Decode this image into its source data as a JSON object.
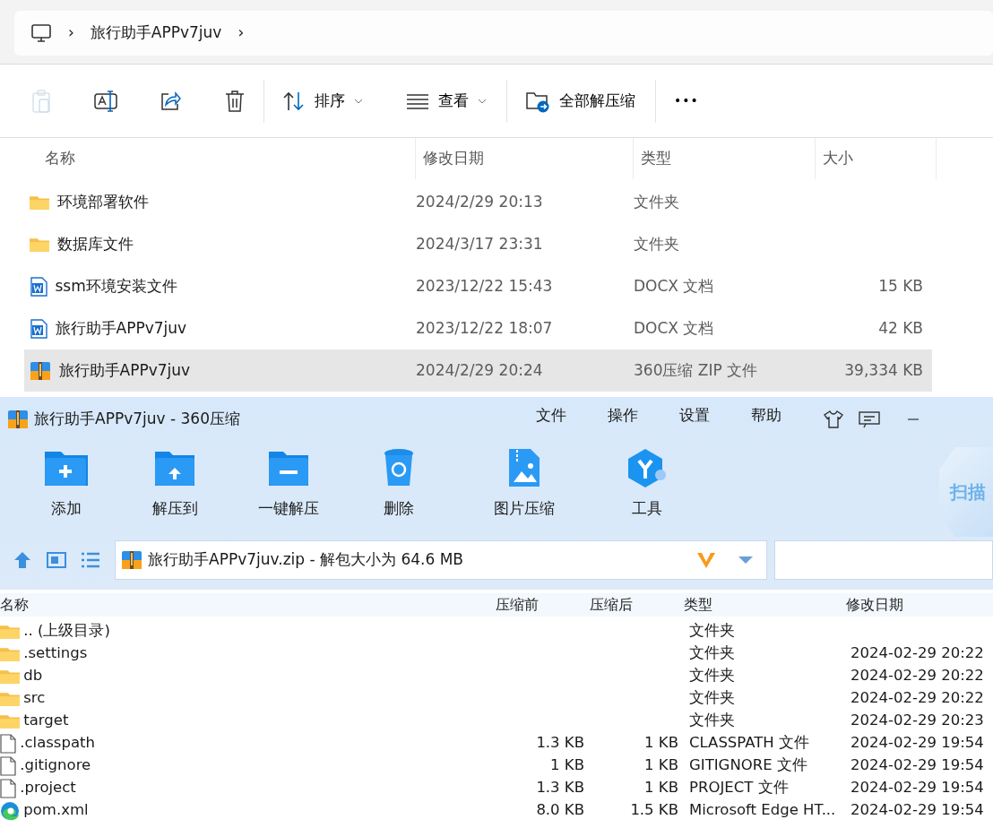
{
  "explorer": {
    "breadcrumb": [
      {
        "kind": "computer"
      },
      {
        "kind": "separator",
        "label": "›"
      },
      {
        "kind": "folder",
        "label": "旅行助手APPv7juv"
      },
      {
        "kind": "separator",
        "label": "›"
      }
    ],
    "toolbar": [
      {
        "kind": "icon",
        "disabled": true
      },
      {
        "kind": "icon",
        "disabled": false
      },
      {
        "kind": "icon",
        "disabled": false
      },
      {
        "kind": "icon",
        "disabled": false
      },
      {
        "kind": "divider"
      },
      {
        "kind": "dropdown",
        "label": "排序"
      },
      {
        "kind": "dropdown",
        "label": "查看"
      },
      {
        "kind": "divider"
      },
      {
        "kind": "text",
        "label": "全部解压缩"
      },
      {
        "kind": "divider"
      },
      {
        "kind": "more",
        "label": "•••"
      }
    ],
    "columns": [
      "名称",
      "修改日期",
      "类型",
      "大小"
    ],
    "rows": [
      {
        "kind": "folder",
        "name": "环境部署软件",
        "date": "2024/2/29 20:13",
        "type": "文件夹",
        "selected": false
      },
      {
        "kind": "folder",
        "name": "数据库文件",
        "date": "2024/3/17 23:31",
        "type": "文件夹",
        "selected": false
      },
      {
        "kind": "document",
        "name": "ssm环境安装文件",
        "date": "2023/12/22 15:43",
        "type": "DOCX 文档",
        "size": "15 KB",
        "selected": false
      },
      {
        "kind": "document",
        "name": "旅行助手APPv7juv",
        "date": "2023/12/22 18:07",
        "type": "DOCX 文档",
        "size": "42 KB",
        "selected": false
      },
      {
        "kind": "archive",
        "name": "旅行助手APPv7juv",
        "date": "2024/2/29 20:24",
        "type": "360压缩 ZIP 文件",
        "size": "39,334 KB",
        "selected": true
      }
    ]
  },
  "archiver": {
    "title": "旅行助手APPv7juv - 360压缩",
    "menu": [
      "文件",
      "操作",
      "设置",
      "帮助"
    ],
    "tools": [
      "添加",
      "解压到",
      "一键解压",
      "删除",
      "图片压缩",
      "工具"
    ],
    "scan_label": "扫描",
    "path": "旅行助手APPv7juv.zip - 解包大小为 64.6 MB",
    "columns": [
      "名称",
      "压缩前",
      "压缩后",
      "类型",
      "修改日期"
    ],
    "rows": [
      {
        "kind": "folder",
        "name": ".. (上级目录)",
        "type": "文件夹"
      },
      {
        "kind": "folder",
        "name": ".settings",
        "type": "文件夹",
        "date": "2024-02-29 20:22"
      },
      {
        "kind": "folder",
        "name": "db",
        "type": "文件夹",
        "date": "2024-02-29 20:22"
      },
      {
        "kind": "folder",
        "name": "src",
        "type": "文件夹",
        "date": "2024-02-29 20:22"
      },
      {
        "kind": "folder",
        "name": "target",
        "type": "文件夹",
        "date": "2024-02-29 20:23"
      },
      {
        "kind": "file",
        "name": ".classpath",
        "before": "1.3 KB",
        "after": "1 KB",
        "type": "CLASSPATH 文件",
        "date": "2024-02-29 19:54"
      },
      {
        "kind": "file",
        "name": ".gitignore",
        "before": "1 KB",
        "after": "1 KB",
        "type": "GITIGNORE 文件",
        "date": "2024-02-29 19:54"
      },
      {
        "kind": "file",
        "name": ".project",
        "before": "1.3 KB",
        "after": "1 KB",
        "type": "PROJECT 文件",
        "date": "2024-02-29 19:54"
      },
      {
        "kind": "web",
        "name": "pom.xml",
        "before": "8.0 KB",
        "after": "1.5 KB",
        "type": "Microsoft Edge HT...",
        "date": "2024-02-29 19:54"
      }
    ]
  }
}
